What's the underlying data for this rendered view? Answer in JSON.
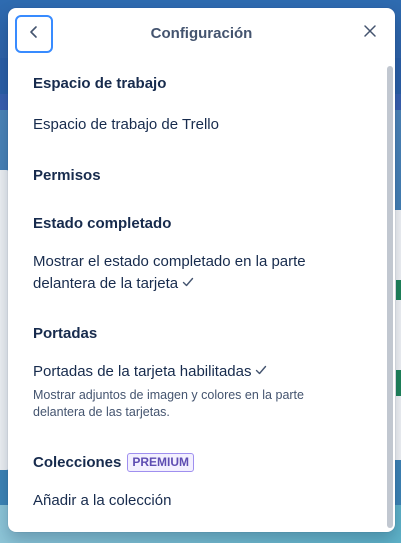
{
  "popover": {
    "title": "Configuración",
    "back_icon": "chevron-left-icon",
    "close_icon": "close-icon"
  },
  "sections": {
    "workspace": {
      "heading": "Espacio de trabajo",
      "item": "Espacio de trabajo de Trello"
    },
    "permissions": {
      "heading": "Permisos"
    },
    "completed_status": {
      "heading": "Estado completado",
      "item_line1": "Mostrar el estado completado en la parte",
      "item_line2": "delantera de la tarjeta",
      "checked": true
    },
    "covers": {
      "heading": "Portadas",
      "item": "Portadas de la tarjeta habilitadas",
      "checked": true,
      "description_line1": "Mostrar adjuntos de imagen y colores en la parte",
      "description_line2": "delantera de las tarjetas."
    },
    "collections": {
      "heading": "Colecciones",
      "badge": "PREMIUM",
      "item": "Añadir a la colección"
    }
  },
  "colors": {
    "accent_focus": "#388bff",
    "text_primary": "#172b4d",
    "text_subtle": "#44546f",
    "premium": "#5e4db2"
  }
}
